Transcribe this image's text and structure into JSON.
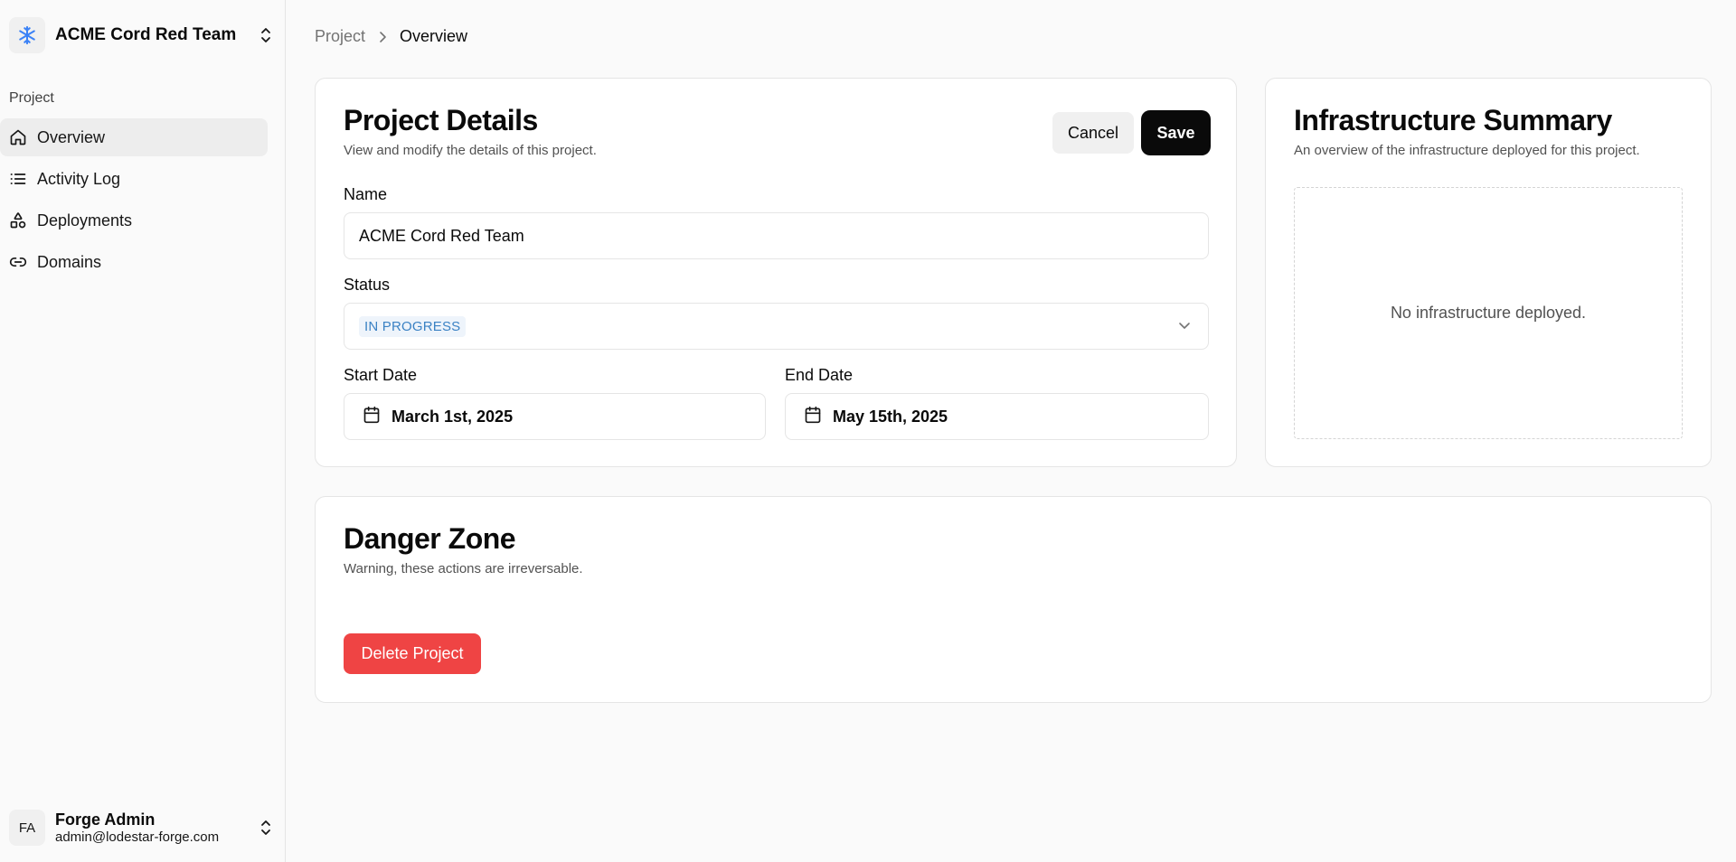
{
  "team": {
    "name": "ACME Cord Red Team"
  },
  "sidebar": {
    "group_label": "Project",
    "items": [
      {
        "label": "Overview",
        "icon": "home-icon",
        "active": true
      },
      {
        "label": "Activity Log",
        "icon": "list-icon",
        "active": false
      },
      {
        "label": "Deployments",
        "icon": "shapes-icon",
        "active": false
      },
      {
        "label": "Domains",
        "icon": "link-icon",
        "active": false
      }
    ]
  },
  "user": {
    "initials": "FA",
    "name": "Forge Admin",
    "email": "admin@lodestar-forge.com"
  },
  "breadcrumb": {
    "parent": "Project",
    "current": "Overview"
  },
  "project_details": {
    "title": "Project Details",
    "description": "View and modify the details of this project.",
    "cancel_label": "Cancel",
    "save_label": "Save",
    "name_label": "Name",
    "name_value": "ACME Cord Red Team",
    "status_label": "Status",
    "status_value": "IN PROGRESS",
    "start_label": "Start Date",
    "start_value": "March 1st, 2025",
    "end_label": "End Date",
    "end_value": "May 15th, 2025"
  },
  "infrastructure": {
    "title": "Infrastructure Summary",
    "description": "An overview of the infrastructure deployed for this project.",
    "empty_text": "No infrastructure deployed."
  },
  "danger_zone": {
    "title": "Danger Zone",
    "description": "Warning, these actions are irreversable.",
    "delete_label": "Delete Project"
  },
  "colors": {
    "accent": "#3b82c4",
    "danger": "#ef4444",
    "primary": "#0a0a0a"
  }
}
